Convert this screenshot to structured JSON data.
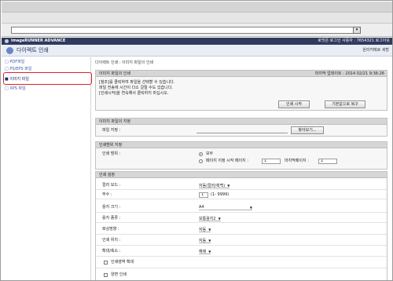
{
  "browser": {
    "address_button": "▾"
  },
  "header": {
    "brand": "imageRUNNER ADVANCE",
    "user_info": "로밋은 로그인 사용자 : 7654321 로그아웃"
  },
  "titlebar": {
    "title": "다이렉트 인쇄",
    "top_link": "원리커메로 세방"
  },
  "sidebar": {
    "items": [
      {
        "label": "PDF파일"
      },
      {
        "label": "PS/EPS 파일"
      },
      {
        "label": "이미지 파일"
      },
      {
        "label": "XPS 파일"
      }
    ]
  },
  "breadcrumb": "다이렉트 인쇄 : 이미지 파일의 인쇄",
  "file_panel": {
    "title": "이미지 파일의 인쇄",
    "date": "마지막 업데이트 : 2014 02/21 9:36:26",
    "lines": [
      "[참조]를 클릭하여 파일을 선택할 수 있습니다.",
      "파일 전송에 시간이 다소 걸릴 수도 있습니다.",
      "[인쇄시작]을 연속해서 클릭하지 마십시오."
    ],
    "print_button": "인쇄 시작",
    "restore_button": "기본값으로 복구"
  },
  "file_select": {
    "title": "이미지 파일의 지정",
    "path_label": "파일 지정 :",
    "browse_button": "찾아보기..."
  },
  "range": {
    "title": "인쇄범위 지정",
    "label": "인쇄 범위 :",
    "all": "모두",
    "page_from": "페이지 지정 시작 페이지 :",
    "from_value": "1",
    "page_to": "마지막페이지 :",
    "to_value": "1"
  },
  "settings": {
    "title": "인쇄 설정",
    "rows": [
      {
        "label": "컬러 모드 :",
        "value": "자동(컬러/흑백)"
      },
      {
        "label": "부수 :",
        "value": "1",
        "hint": "(1- 9999)"
      },
      {
        "label": "용지 크기 :",
        "value": "A4"
      },
      {
        "label": "용지 종류 :",
        "value": "보통용지2"
      },
      {
        "label": "화상방향 :",
        "value": "자동"
      },
      {
        "label": "인쇄 위치 :",
        "value": "자동"
      },
      {
        "label": "확대/축소 :",
        "value": "해제"
      }
    ],
    "checkbox_fit": "인쇄영역 확대",
    "checkbox_duplex": "양면 인쇄"
  },
  "colors": {
    "header": "#2f3a5c",
    "link": "#3e5aa5",
    "highlight": "#e0202a"
  }
}
